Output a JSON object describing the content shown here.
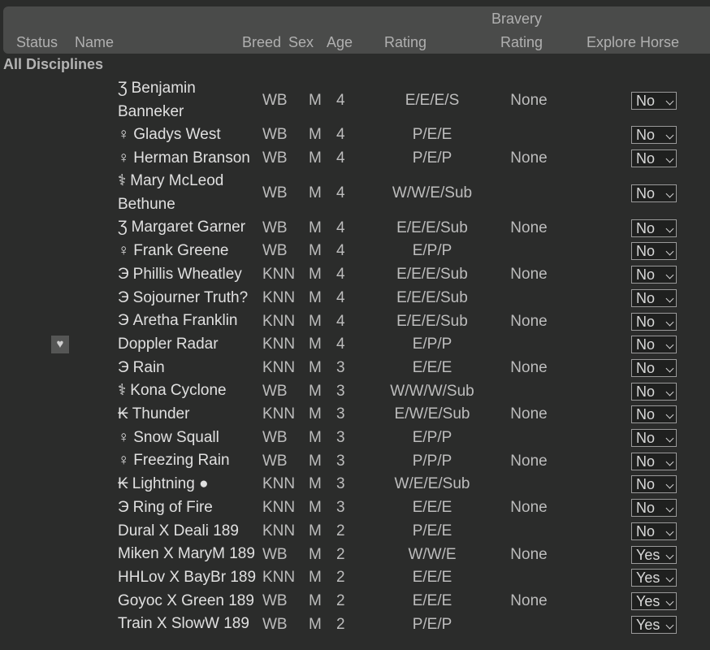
{
  "header": {
    "status": "Status",
    "name": "Name",
    "breed": "Breed",
    "sex": "Sex",
    "age": "Age",
    "rating": "Rating",
    "bravery_line1": "Bravery",
    "bravery_line2": "Rating",
    "explore": "Explore Horse"
  },
  "group": "All Disciplines",
  "status_icon": "heart-icon",
  "rows": [
    {
      "sym": "Ʒ",
      "name": "Benjamin",
      "name2": "Banneker",
      "breed": "WB",
      "sex": "M",
      "age": "4",
      "rating": "E/E/E/S",
      "bravery": "None",
      "explore": "No"
    },
    {
      "sym": "♀",
      "name": "Gladys West",
      "breed": "WB",
      "sex": "M",
      "age": "4",
      "rating": "P/E/E",
      "bravery": "",
      "explore": "No"
    },
    {
      "sym": "♀",
      "name": "Herman Branson",
      "breed": "WB",
      "sex": "M",
      "age": "4",
      "rating": "P/E/P",
      "bravery": "None",
      "explore": "No"
    },
    {
      "sym": "⚕",
      "name": "Mary McLeod",
      "name2": "Bethune",
      "breed": "WB",
      "sex": "M",
      "age": "4",
      "rating": "W/W/E/Sub",
      "bravery": "",
      "explore": "No"
    },
    {
      "sym": "Ʒ",
      "name": "Margaret Garner",
      "breed": "WB",
      "sex": "M",
      "age": "4",
      "rating": "E/E/E/Sub",
      "bravery": "None",
      "explore": "No"
    },
    {
      "sym": "♀",
      "name": "Frank Greene",
      "breed": "WB",
      "sex": "M",
      "age": "4",
      "rating": "E/P/P",
      "bravery": "",
      "explore": "No"
    },
    {
      "sym": "Э",
      "name": "Phillis Wheatley",
      "breed": "KNN",
      "sex": "M",
      "age": "4",
      "rating": "E/E/E/Sub",
      "bravery": "None",
      "explore": "No"
    },
    {
      "sym": "Э",
      "name": "Sojourner Truth?",
      "breed": "KNN",
      "sex": "M",
      "age": "4",
      "rating": "E/E/E/Sub",
      "bravery": "",
      "explore": "No"
    },
    {
      "sym": "Э",
      "name": "Aretha Franklin",
      "breed": "KNN",
      "sex": "M",
      "age": "4",
      "rating": "E/E/E/Sub",
      "bravery": "None",
      "explore": "No"
    },
    {
      "sym": "",
      "name": "Doppler Radar",
      "breed": "KNN",
      "sex": "M",
      "age": "4",
      "rating": "E/P/P",
      "bravery": "",
      "explore": "No",
      "heart": "♥"
    },
    {
      "sym": "Э",
      "name": "Rain",
      "breed": "KNN",
      "sex": "M",
      "age": "3",
      "rating": "E/E/E",
      "bravery": "None",
      "explore": "No"
    },
    {
      "sym": "⚕",
      "name": "Kona Cyclone",
      "breed": "WB",
      "sex": "M",
      "age": "3",
      "rating": "W/W/W/Sub",
      "bravery": "",
      "explore": "No"
    },
    {
      "sym": "₭",
      "name": "Thunder",
      "breed": "KNN",
      "sex": "M",
      "age": "3",
      "rating": "E/W/E/Sub",
      "bravery": "None",
      "explore": "No"
    },
    {
      "sym": "♀",
      "name": "Snow Squall",
      "breed": "WB",
      "sex": "M",
      "age": "3",
      "rating": "E/P/P",
      "bravery": "",
      "explore": "No"
    },
    {
      "sym": "♀",
      "name": "Freezing Rain",
      "breed": "WB",
      "sex": "M",
      "age": "3",
      "rating": "P/P/P",
      "bravery": "None",
      "explore": "No"
    },
    {
      "sym": "₭",
      "name": "Lightning ●",
      "breed": "KNN",
      "sex": "M",
      "age": "3",
      "rating": "W/E/E/Sub",
      "bravery": "",
      "explore": "No"
    },
    {
      "sym": "Э",
      "name": "Ring of Fire",
      "breed": "KNN",
      "sex": "M",
      "age": "3",
      "rating": "E/E/E",
      "bravery": "None",
      "explore": "No"
    },
    {
      "sym": "",
      "name": "Dural X Deali 189",
      "breed": "KNN",
      "sex": "M",
      "age": "2",
      "rating": "P/E/E",
      "bravery": "",
      "explore": "No"
    },
    {
      "sym": "",
      "name": "Miken X MaryM 189",
      "breed": "WB",
      "sex": "M",
      "age": "2",
      "rating": "W/W/E",
      "bravery": "None",
      "explore": "Yes"
    },
    {
      "sym": "",
      "name": "HHLov X BayBr 189",
      "breed": "KNN",
      "sex": "M",
      "age": "2",
      "rating": "E/E/E",
      "bravery": "",
      "explore": "Yes"
    },
    {
      "sym": "",
      "name": "Goyoc X Green 189",
      "breed": "WB",
      "sex": "M",
      "age": "2",
      "rating": "E/E/E",
      "bravery": "None",
      "explore": "Yes"
    },
    {
      "sym": "",
      "name": "Train X SlowW 189",
      "breed": "WB",
      "sex": "M",
      "age": "2",
      "rating": "P/E/P",
      "bravery": "",
      "explore": "Yes"
    }
  ]
}
